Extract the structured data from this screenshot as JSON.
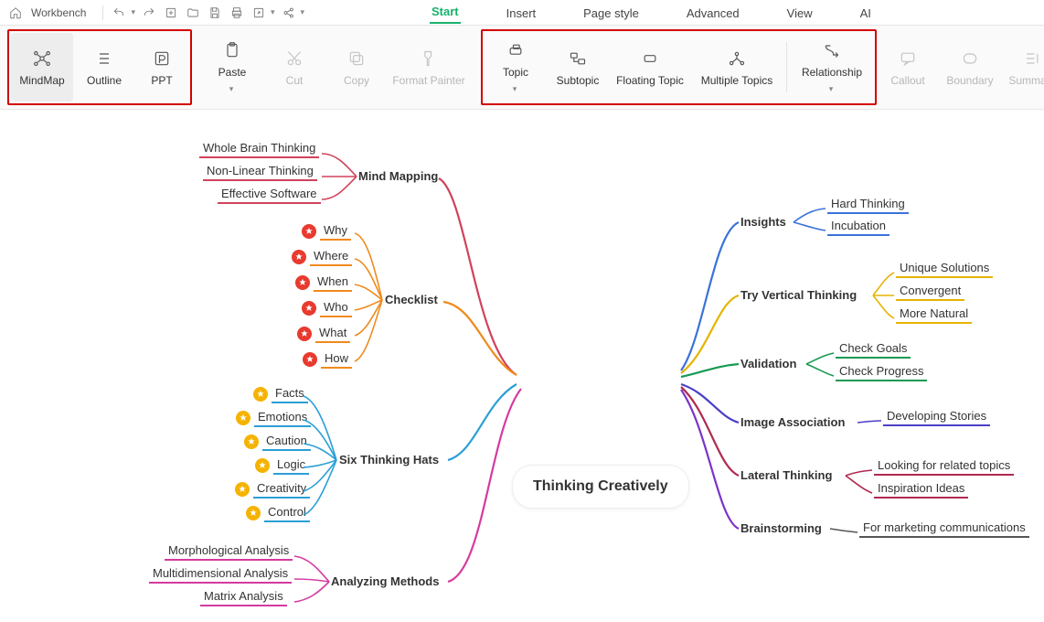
{
  "topbar": {
    "workbench": "Workbench"
  },
  "menu": {
    "start": "Start",
    "insert": "Insert",
    "pagestyle": "Page style",
    "advanced": "Advanced",
    "view": "View",
    "ai": "AI"
  },
  "ribbon": {
    "views": {
      "mindmap": "MindMap",
      "outline": "Outline",
      "ppt": "PPT"
    },
    "clipboard": {
      "paste": "Paste",
      "cut": "Cut",
      "copy": "Copy",
      "formatpainter": "Format Painter"
    },
    "topics": {
      "topic": "Topic",
      "subtopic": "Subtopic",
      "floating": "Floating Topic",
      "multiple": "Multiple Topics",
      "relationship": "Relationship"
    },
    "extras": {
      "callout": "Callout",
      "boundary": "Boundary",
      "summary": "Summary"
    }
  },
  "map": {
    "center": "Thinking Creatively",
    "left": {
      "mindmapping": {
        "label": "Mind Mapping",
        "children": [
          "Whole Brain Thinking",
          "Non-Linear Thinking",
          "Effective Software"
        ]
      },
      "checklist": {
        "label": "Checklist",
        "children": [
          "Why",
          "Where",
          "When",
          "Who",
          "What",
          "How"
        ]
      },
      "sixhats": {
        "label": "Six Thinking Hats",
        "children": [
          "Facts",
          "Emotions",
          "Caution",
          "Logic",
          "Creativity",
          "Control"
        ]
      },
      "analyzing": {
        "label": "Analyzing Methods",
        "children": [
          "Morphological Analysis",
          "Multidimensional Analysis",
          "Matrix Analysis"
        ]
      }
    },
    "right": {
      "insights": {
        "label": "Insights",
        "children": [
          "Hard Thinking",
          "Incubation"
        ]
      },
      "vertical": {
        "label": "Try Vertical Thinking",
        "children": [
          "Unique Solutions",
          "Convergent",
          "More Natural"
        ]
      },
      "validation": {
        "label": "Validation",
        "children": [
          "Check Goals",
          "Check Progress"
        ]
      },
      "image": {
        "label": "Image Association",
        "children": [
          "Developing Stories"
        ]
      },
      "lateral": {
        "label": "Lateral Thinking",
        "children": [
          "Looking for related topics",
          "Inspiration Ideas"
        ]
      },
      "brainstorm": {
        "label": "Brainstorming",
        "children": [
          "For marketing communications"
        ]
      }
    }
  }
}
